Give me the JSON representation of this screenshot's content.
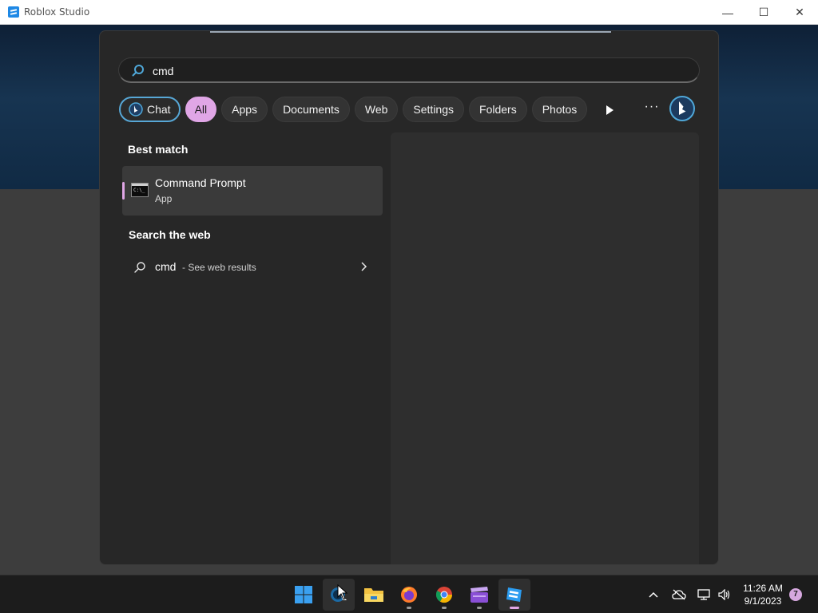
{
  "window": {
    "title": "Roblox Studio",
    "minimize_glyph": "—",
    "maximize_glyph": "☐",
    "close_glyph": "✕"
  },
  "search": {
    "query": "cmd",
    "icon": "search-icon"
  },
  "filters": [
    {
      "label": "Chat",
      "icon": "bing-chat-icon",
      "active": false
    },
    {
      "label": "All",
      "active": true
    },
    {
      "label": "Apps",
      "active": false
    },
    {
      "label": "Documents",
      "active": false
    },
    {
      "label": "Web",
      "active": false
    },
    {
      "label": "Settings",
      "active": false
    },
    {
      "label": "Folders",
      "active": false
    },
    {
      "label": "Photos",
      "active": false
    }
  ],
  "toolbar": {
    "more_glyph": "···"
  },
  "results": {
    "best_match_label": "Best match",
    "best_match": {
      "title": "Command Prompt",
      "subtitle": "App",
      "icon": "command-prompt-icon"
    },
    "search_web_label": "Search the web",
    "web": {
      "query": "cmd",
      "suffix": "- See web results"
    }
  },
  "taskbar": {
    "items": [
      {
        "name": "start",
        "icon": "windows-start-icon"
      },
      {
        "name": "search",
        "icon": "search-app-icon",
        "hover": true
      },
      {
        "name": "file-explorer",
        "icon": "folder-icon"
      },
      {
        "name": "firefox",
        "icon": "firefox-icon"
      },
      {
        "name": "chrome",
        "icon": "chrome-icon"
      },
      {
        "name": "video-editor",
        "icon": "clapperboard-icon"
      },
      {
        "name": "roblox-studio",
        "icon": "roblox-studio-icon",
        "active": true
      }
    ],
    "tray": {
      "chevron_glyph": "^",
      "time": "11:26 AM",
      "date": "9/1/2023",
      "notifications": "7"
    }
  },
  "colors": {
    "accent": "#e0a6e6",
    "chat_border": "#57a7d6",
    "panel_bg": "#272727",
    "taskbar_bg": "#1c1c1c"
  }
}
